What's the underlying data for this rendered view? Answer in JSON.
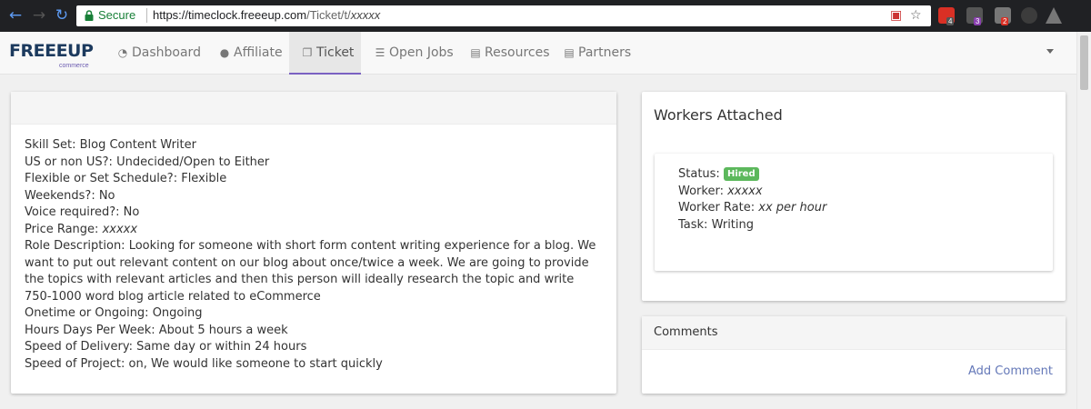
{
  "browser": {
    "secure_label": "Secure",
    "url_base": "https://timeclock.freeeup.com",
    "url_path": "/Ticket/t/",
    "url_masked": "xxxxx",
    "extension_badges": [
      "4",
      "3",
      "2"
    ]
  },
  "logo": {
    "text": "FREEEUP",
    "sub": "commerce"
  },
  "nav": {
    "items": [
      {
        "label": "Dashboard",
        "icon": "dashboard-icon"
      },
      {
        "label": "Affiliate",
        "icon": "users-icon"
      },
      {
        "label": "Ticket",
        "icon": "copy-icon"
      },
      {
        "label": "Open Jobs",
        "icon": "list-icon"
      },
      {
        "label": "Resources",
        "icon": "file-icon"
      },
      {
        "label": "Partners",
        "icon": "file-icon"
      }
    ],
    "active": "Ticket"
  },
  "ticket": {
    "fields": [
      "Skill Set: Blog Content Writer",
      "US or non US?: Undecided/Open to Either",
      "Flexible or Set Schedule?: Flexible",
      "Weekends?: No",
      "Voice required?: No"
    ],
    "price_label": "Price Range:",
    "price_value": "xxxxx",
    "role_description": "Role Description: Looking for someone with short form content writing experience for a blog. We want to put out relevant content on our blog about once/twice a week. We are going to provide the topics with relevant articles and then this person will ideally research the topic and write 750-1000 word blog article related to eCommerce",
    "fields_after": [
      "Onetime or Ongoing: Ongoing",
      "Hours Days Per Week: About 5 hours a week",
      "Speed of Delivery: Same day or within 24 hours",
      "Speed of Project: on, We would like someone to start quickly"
    ]
  },
  "workers": {
    "title": "Workers Attached",
    "status_label": "Status:",
    "status_value": "Hired",
    "worker_label": "Worker:",
    "worker_value": "xxxxx",
    "rate_label": "Worker Rate:",
    "rate_value": "xx per hour",
    "task_label": "Task:",
    "task_value": "Writing"
  },
  "comments": {
    "title": "Comments",
    "add_label": "Add Comment"
  },
  "colors": {
    "accent": "#7b61c2",
    "hired": "#5cb85c",
    "link": "#6478b8",
    "secure": "#188038"
  }
}
